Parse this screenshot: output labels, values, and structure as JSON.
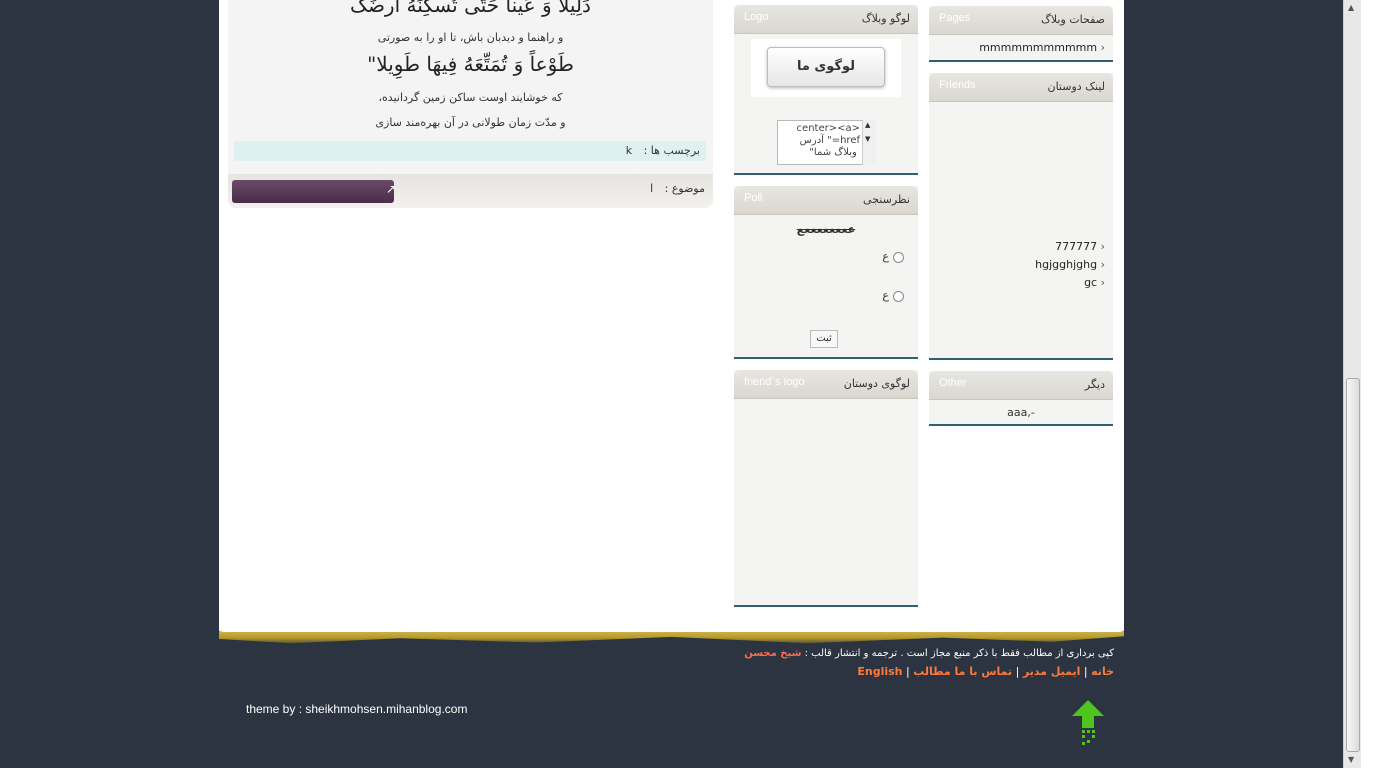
{
  "post": {
    "line1": "دَلِیلا وَ عَیناً حَتّی تُسکِنَهُ اَرضَکَ",
    "line2": "و راهنما و دیدبان باش، تا او را به صورتی",
    "line3": "طَوْعاً وَ تُمَتِّعَهُ فِیهَا طَوِیلا\"",
    "line4": "که خوشایند اوست ساکن زمین گردانیده،",
    "line5": "و مدّت زمان طولانی در آن بهره‌مند سازی",
    "tags_label": "برچسب ها :",
    "tags_value": "k",
    "subject_label": "موضوع :",
    "subject_value": "ا"
  },
  "pages_box": {
    "title_fa": "صفحات وبلاگ",
    "title_en": "Pages",
    "items": [
      "mmmmmmmmmmm"
    ]
  },
  "logo_box": {
    "title_fa": "لوگو وبلاگ",
    "title_en": "Logo",
    "logo_text": "لوگوی ما",
    "code_text": "<center><a\nhref=\" آدرس\n وبلاگ شما\""
  },
  "friends_box": {
    "title_fa": "لینک دوستان",
    "title_en": "Friends",
    "items": [
      "777777",
      "hgjgghjghg",
      "gc"
    ]
  },
  "poll_box": {
    "title_fa": "نظرسنجی",
    "title_en": "Poll",
    "question": "ععععععععع",
    "options": [
      "ع",
      "ع"
    ],
    "submit": "ثبت"
  },
  "other_box": {
    "title_fa": "دیگر",
    "title_en": "Other",
    "items": [
      "aaa,-"
    ]
  },
  "friends_logo_box": {
    "title_fa": "لوگوی دوستان",
    "title_en": "friend`s logo"
  },
  "footer": {
    "copyright": "کپی برداری از مطالب فقط با ذکر منبع مجاز است . ترجمه و انتشار قالب :",
    "author": "شیخ محسن",
    "link_home": "خانه",
    "link_email": "ایمیل مدیر",
    "link_contact": "تماس با ما مطالب",
    "link_english": "English",
    "sep": "|",
    "theme_by": "theme by : sheikhmohsen.mihanblog.com"
  }
}
